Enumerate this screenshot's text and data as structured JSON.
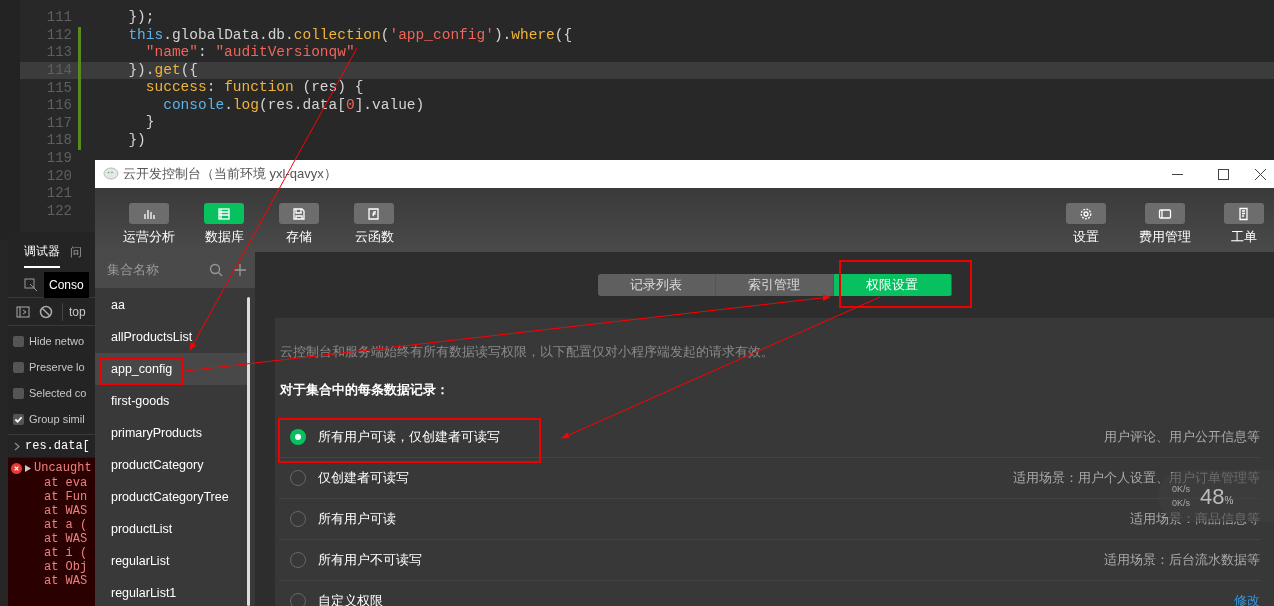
{
  "editor": {
    "lines": [
      {
        "number": "111",
        "tokens": [
          {
            "kind": "plain",
            "text": "  });"
          }
        ]
      },
      {
        "number": "112",
        "modified": true,
        "tokens": [
          {
            "kind": "keyword",
            "text": "  this"
          },
          {
            "kind": "plain",
            "text": ".globalData.db."
          },
          {
            "kind": "method",
            "text": "collection"
          },
          {
            "kind": "plain",
            "text": "("
          },
          {
            "kind": "string",
            "text": "'app_config'"
          },
          {
            "kind": "plain",
            "text": ")."
          },
          {
            "kind": "method",
            "text": "where"
          },
          {
            "kind": "plain",
            "text": "({"
          }
        ]
      },
      {
        "number": "113",
        "modified": true,
        "tokens": [
          {
            "kind": "string",
            "text": "    \"name\""
          },
          {
            "kind": "plain",
            "text": ": "
          },
          {
            "kind": "string",
            "text": "\"auditVersionqw\""
          }
        ]
      },
      {
        "number": "114",
        "modified": true,
        "current": true,
        "tokens": [
          {
            "kind": "plain",
            "text": "  })."
          },
          {
            "kind": "method",
            "text": "get"
          },
          {
            "kind": "plain",
            "text": "({"
          }
        ]
      },
      {
        "number": "115",
        "modified": true,
        "tokens": [
          {
            "kind": "method",
            "text": "    success"
          },
          {
            "kind": "plain",
            "text": ": "
          },
          {
            "kind": "method",
            "text": "function"
          },
          {
            "kind": "plain",
            "text": " (res) {"
          }
        ]
      },
      {
        "number": "116",
        "modified": true,
        "tokens": [
          {
            "kind": "keyword",
            "text": "      console"
          },
          {
            "kind": "plain",
            "text": "."
          },
          {
            "kind": "method",
            "text": "log"
          },
          {
            "kind": "plain",
            "text": "(res.data["
          },
          {
            "kind": "string",
            "text": "0"
          },
          {
            "kind": "plain",
            "text": "].value)"
          }
        ]
      },
      {
        "number": "117",
        "modified": true,
        "tokens": [
          {
            "kind": "plain",
            "text": "    }"
          }
        ]
      },
      {
        "number": "118",
        "modified": true,
        "tokens": [
          {
            "kind": "plain",
            "text": "  })"
          }
        ]
      },
      {
        "number": "119"
      },
      {
        "number": "120"
      },
      {
        "number": "121"
      },
      {
        "number": "122"
      }
    ]
  },
  "devtools": {
    "tabs": [
      {
        "label": "调试器",
        "selected": true
      },
      {
        "label": "问",
        "selected": false
      }
    ],
    "console_tab": "Conso",
    "context": "top",
    "options": [
      {
        "label": "Hide netwo",
        "checked": false
      },
      {
        "label": "Preserve lo",
        "checked": false
      },
      {
        "label": "Selected co",
        "checked": false
      },
      {
        "label": "Group simil",
        "checked": true
      }
    ],
    "input": "res.data[",
    "error": {
      "message": "Uncaught",
      "stack": [
        "at eva",
        "at Fun",
        "at WAS",
        "at a (",
        "at WAS",
        "at i (",
        "at Obj",
        "at WAS"
      ]
    }
  },
  "window": {
    "title": "云开发控制台（当前环境 yxl-qavyx）",
    "toolbar_left": [
      {
        "label": "运营分析",
        "selected": false
      },
      {
        "label": "数据库",
        "selected": true
      },
      {
        "label": "存储",
        "selected": false
      },
      {
        "label": "云函数",
        "selected": false
      }
    ],
    "toolbar_right": [
      {
        "label": "设置",
        "selected": false
      },
      {
        "label": "费用管理",
        "selected": false
      },
      {
        "label": "工单",
        "selected": false
      }
    ],
    "sidebar": {
      "header": "集合名称",
      "items": [
        {
          "name": "aa",
          "selected": false
        },
        {
          "name": "allProductsList",
          "selected": false
        },
        {
          "name": "app_config",
          "selected": true
        },
        {
          "name": "first-goods",
          "selected": false
        },
        {
          "name": "primaryProducts",
          "selected": false
        },
        {
          "name": "productCategory",
          "selected": false
        },
        {
          "name": "productCategoryTree",
          "selected": false
        },
        {
          "name": "productList",
          "selected": false
        },
        {
          "name": "regularList",
          "selected": false
        },
        {
          "name": "regularList1",
          "selected": false
        }
      ]
    },
    "tabs": [
      {
        "label": "记录列表",
        "selected": false
      },
      {
        "label": "索引管理",
        "selected": false
      },
      {
        "label": "权限设置",
        "selected": true
      }
    ],
    "note": "云控制台和服务端始终有所有数据读写权限，以下配置仅对小程序端发起的请求有效。",
    "heading": "对于集合中的每条数据记录：",
    "options": [
      {
        "label": "所有用户可读，仅创建者可读写",
        "hint": "用户评论、用户公开信息等",
        "selected": true
      },
      {
        "label": "仅创建者可读写",
        "hint": "适用场景：用户个人设置、用户订单管理等",
        "selected": false
      },
      {
        "label": "所有用户可读",
        "hint": "适用场景：商品信息等",
        "selected": false
      },
      {
        "label": "所有用户不可读写",
        "hint": "适用场景：后台流水数据等",
        "selected": false
      },
      {
        "label": "自定义权限",
        "link": "修改",
        "selected": false
      }
    ]
  },
  "network_widget": {
    "upload": "0K/s",
    "download": "0K/s",
    "percent": "48",
    "unit": "%"
  }
}
